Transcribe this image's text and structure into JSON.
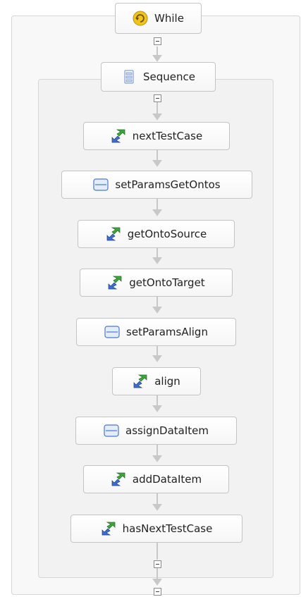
{
  "while": {
    "label": "While",
    "icon": "while-loop-icon"
  },
  "sequence": {
    "label": "Sequence",
    "icon": "sequence-icon"
  },
  "activities": [
    {
      "label": "nextTestCase",
      "icon": "invoke-icon"
    },
    {
      "label": "setParamsGetOntos",
      "icon": "assign-icon"
    },
    {
      "label": "getOntoSource",
      "icon": "invoke-icon"
    },
    {
      "label": "getOntoTarget",
      "icon": "invoke-icon"
    },
    {
      "label": "setParamsAlign",
      "icon": "assign-icon"
    },
    {
      "label": "align",
      "icon": "invoke-icon"
    },
    {
      "label": "assignDataItem",
      "icon": "assign-icon"
    },
    {
      "label": "addDataItem",
      "icon": "invoke-icon"
    },
    {
      "label": "hasNextTestCase",
      "icon": "invoke-icon"
    }
  ],
  "colors": {
    "connector": "#c8c8c8",
    "invoke_green": "#3fa53f",
    "invoke_blue": "#3c6fd1",
    "assign_blue": "#4a78c8",
    "while_yellow": "#f0c419"
  }
}
